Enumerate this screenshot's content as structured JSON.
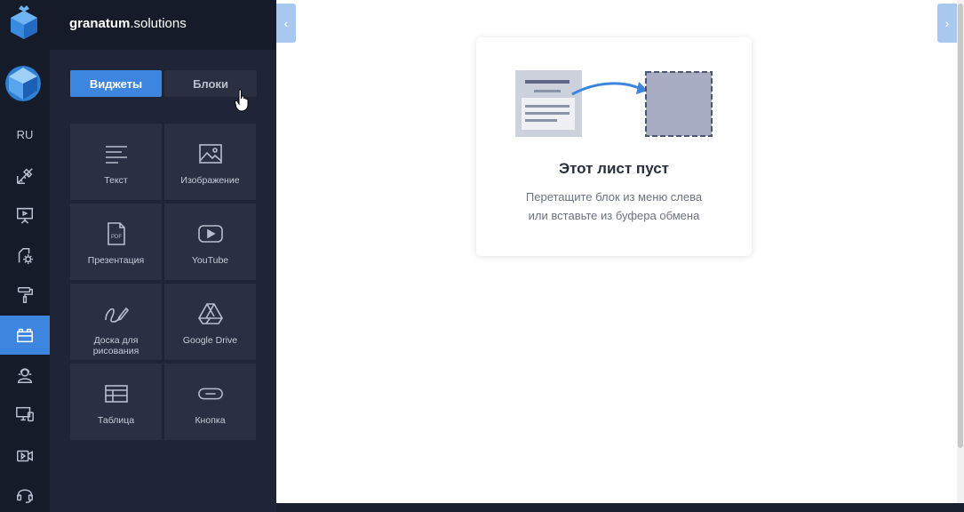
{
  "brand": {
    "name_bold": "granatum",
    "name_rest": ".solutions"
  },
  "rail": {
    "language": "RU",
    "items": [
      {
        "icon": "design-ruler-icon"
      },
      {
        "icon": "presentation-board-icon"
      },
      {
        "icon": "settings-gear-icon"
      },
      {
        "icon": "paint-roller-icon"
      },
      {
        "icon": "blocks-icon",
        "active": true
      },
      {
        "icon": "user-support-icon"
      },
      {
        "icon": "devices-icon"
      },
      {
        "icon": "video-camera-icon"
      },
      {
        "icon": "headset-icon"
      }
    ]
  },
  "panel": {
    "tabs": {
      "widgets": "Виджеты",
      "blocks": "Блоки"
    },
    "tiles": [
      {
        "icon": "text-lines-icon",
        "label": "Текст"
      },
      {
        "icon": "image-icon",
        "label": "Изображение"
      },
      {
        "icon": "pdf-icon",
        "label": "Презентация"
      },
      {
        "icon": "youtube-play-icon",
        "label": "YouTube"
      },
      {
        "icon": "pencil-draw-icon",
        "label": "Доска для рисования"
      },
      {
        "icon": "google-drive-icon",
        "label": "Google Drive"
      },
      {
        "icon": "table-icon",
        "label": "Таблица"
      },
      {
        "icon": "button-icon",
        "label": "Кнопка"
      }
    ]
  },
  "canvas": {
    "empty_title": "Этот лист пуст",
    "empty_hint_line1": "Перетащите блок из меню слева",
    "empty_hint_line2": "или вставьте из буфера обмена"
  },
  "colors": {
    "accent": "#3d86e0",
    "rail_bg": "#161b29",
    "panel_bg": "#1f2536",
    "tile_bg": "#2a3043"
  }
}
